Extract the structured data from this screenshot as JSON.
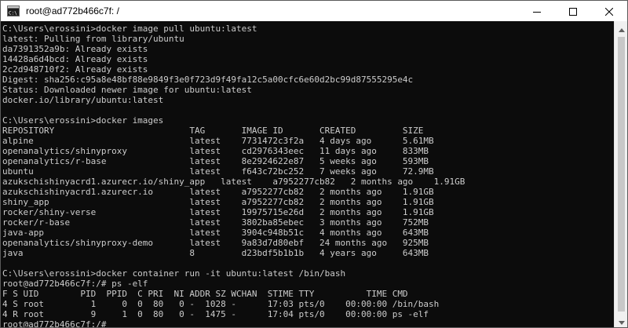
{
  "window": {
    "title": "root@ad772b466c7f: /",
    "app_icon": "cmd-icon",
    "controls": [
      "minimize-icon",
      "maximize-icon",
      "close-icon"
    ]
  },
  "terminal": {
    "lines": [
      "C:\\Users\\erossini>docker image pull ubuntu:latest",
      "latest: Pulling from library/ubuntu",
      "da7391352a9b: Already exists",
      "14428a6d4bcd: Already exists",
      "2c2d948710f2: Already exists",
      "Digest: sha256:c95a8e48bf88e9849f3e0f723d9f49fa12c5a00cfc6e60d2bc99d87555295e4c",
      "Status: Downloaded newer image for ubuntu:latest",
      "docker.io/library/ubuntu:latest",
      "",
      "C:\\Users\\erossini>docker images",
      "REPOSITORY                          TAG       IMAGE ID       CREATED         SIZE",
      "alpine                              latest    7731472c3f2a   4 days ago      5.61MB",
      "openanalytics/shinyproxy            latest    cd2976343eec   11 days ago     833MB",
      "openanalytics/r-base                latest    8e2924622e87   5 weeks ago     593MB",
      "ubuntu                              latest    f643c72bc252   7 weeks ago     72.9MB",
      "azukschishinyacrd1.azurecr.io/shiny_app   latest    a7952277cb82   2 months ago    1.91GB",
      "azukschishinyacrd1.azurecr.io       latest    a7952277cb82   2 months ago    1.91GB",
      "shiny_app                           latest    a7952277cb82   2 months ago    1.91GB",
      "rocker/shiny-verse                  latest    19975715e26d   2 months ago    1.91GB",
      "rocker/r-base                       latest    3802ba85ebec   3 months ago    752MB",
      "java-app                            latest    3904c948b51c   4 months ago    643MB",
      "openanalytics/shinyproxy-demo       latest    9a83d7d80ebf   24 months ago   925MB",
      "java                                8         d23bdf5b1b1b   4 years ago     643MB",
      "",
      "C:\\Users\\erossini>docker container run -it ubuntu:latest /bin/bash",
      "root@ad772b466c7f:/# ps -elf",
      "F S UID        PID  PPID  C PRI  NI ADDR SZ WCHAN  STIME TTY          TIME CMD",
      "4 S root         1     0  0  80   0 -  1028 -      17:03 pts/0    00:00:00 /bin/bash",
      "4 R root         9     1  0  80   0 -  1475 -      17:04 pts/0    00:00:00 ps -elf",
      "root@ad772b466c7f:/# "
    ]
  }
}
